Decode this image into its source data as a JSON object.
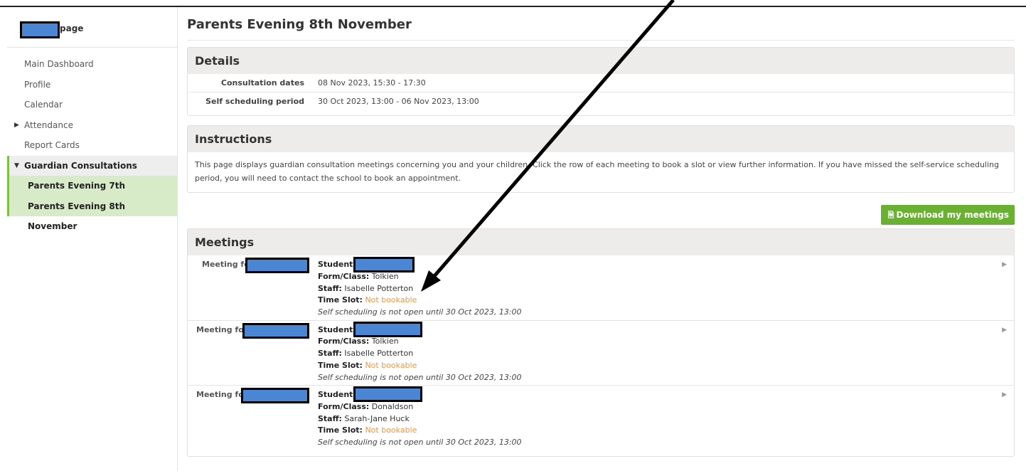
{
  "sidebar": {
    "header_suffix": "page",
    "items": [
      {
        "label": "Main Dashboard"
      },
      {
        "label": "Profile"
      },
      {
        "label": "Calendar"
      },
      {
        "label": "Attendance"
      },
      {
        "label": "Report Cards"
      },
      {
        "label": "Guardian Consultations"
      },
      {
        "label": "Parents Evening 7th November"
      },
      {
        "label": "Parents Evening 8th November"
      }
    ]
  },
  "main": {
    "title": "Parents Evening 8th November",
    "details": {
      "heading": "Details",
      "rows": [
        {
          "key": "Consultation dates",
          "value": "08 Nov 2023, 15:30 - 17:30"
        },
        {
          "key": "Self scheduling period",
          "value": "30 Oct 2023, 13:00 - 06 Nov 2023, 13:00"
        }
      ]
    },
    "instructions": {
      "heading": "Instructions",
      "text": "This page displays guardian consultation meetings concerning you and your children. Click the row of each meeting to book a slot or view further information. If you have missed the self-service scheduling period, you will need to contact the school to book an appointment."
    },
    "download_label": "Download my meetings",
    "meetings": {
      "heading": "Meetings",
      "meeting_for_label": "Meeting for",
      "students_label": "Students:",
      "form_label": "Form/Class:",
      "staff_label": "Staff:",
      "timeslot_label": "Time Slot:",
      "rows": [
        {
          "form": "Tolkien",
          "staff": "Isabelle Potterton",
          "timeslot": "Not bookable",
          "note": "Self scheduling is not open until 30 Oct 2023, 13:00"
        },
        {
          "form": "Tolkien",
          "staff": "Isabelle Potterton",
          "timeslot": "Not bookable",
          "note": "Self scheduling is not open until 30 Oct 2023, 13:00"
        },
        {
          "form": "Donaldson",
          "staff": "Sarah-Jane Huck",
          "timeslot": "Not bookable",
          "note": "Self scheduling is not open until 30 Oct 2023, 13:00"
        }
      ]
    }
  },
  "colors": {
    "accent_green": "#6ab033",
    "not_bookable": "#f0963c",
    "redaction_fill": "#4a86d4"
  }
}
